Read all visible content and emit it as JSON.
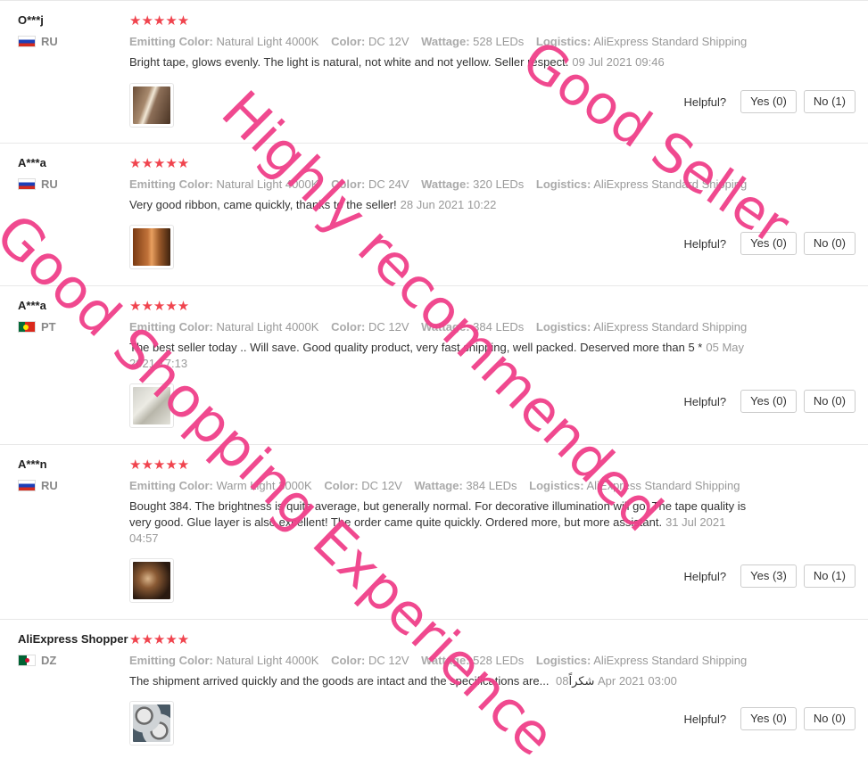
{
  "helpful_label": "Helpful?",
  "colors": {
    "stars": "#f0444e",
    "watermark": "#f0408a"
  },
  "reviews": [
    {
      "user": "O***j",
      "country": "RU",
      "flag": "flag-russia-icon",
      "stars": "★★★★★",
      "attrs": [
        {
          "label": "Emitting Color:",
          "value": "Natural Light 4000K"
        },
        {
          "label": "Color:",
          "value": "DC 12V"
        },
        {
          "label": "Wattage:",
          "value": "528 LEDs"
        },
        {
          "label": "Logistics:",
          "value": "AliExpress Standard Shipping"
        }
      ],
      "text": "Bright tape, glows evenly. The light is natural, not white and not yellow. Seller respect.",
      "date": "09 Jul 2021 09:46",
      "yes": "Yes (0)",
      "no": "No (1)"
    },
    {
      "user": "A***a",
      "country": "RU",
      "flag": "flag-russia-icon",
      "stars": "★★★★★",
      "attrs": [
        {
          "label": "Emitting Color:",
          "value": "Natural Light 4000K"
        },
        {
          "label": "Color:",
          "value": "DC 24V"
        },
        {
          "label": "Wattage:",
          "value": "320 LEDs"
        },
        {
          "label": "Logistics:",
          "value": "AliExpress Standard Shipping"
        }
      ],
      "text": "Very good ribbon, came quickly, thanks to the seller!",
      "date": "28 Jun 2021 10:22",
      "yes": "Yes (0)",
      "no": "No (0)"
    },
    {
      "user": "A***a",
      "country": "PT",
      "flag": "flag-portugal-icon",
      "stars": "★★★★★",
      "attrs": [
        {
          "label": "Emitting Color:",
          "value": "Natural Light 4000K"
        },
        {
          "label": "Color:",
          "value": "DC 12V"
        },
        {
          "label": "Wattage:",
          "value": "384 LEDs"
        },
        {
          "label": "Logistics:",
          "value": "AliExpress Standard Shipping"
        }
      ],
      "text": "The best seller today .. Will save. Good quality product, very fast shipping, well packed. Deserved more than 5 *",
      "date": "05 May 2021 17:13",
      "yes": "Yes (0)",
      "no": "No (0)"
    },
    {
      "user": "A***n",
      "country": "RU",
      "flag": "flag-russia-icon",
      "stars": "★★★★★",
      "attrs": [
        {
          "label": "Emitting Color:",
          "value": "Warm Light 3000K"
        },
        {
          "label": "Color:",
          "value": "DC 12V"
        },
        {
          "label": "Wattage:",
          "value": "384 LEDs"
        },
        {
          "label": "Logistics:",
          "value": "AliExpress Standard Shipping"
        }
      ],
      "text": "Bought 384. The brightness is quite average, but generally normal. For decorative illumination will go. The tape quality is very good. Glue layer is also excellent! The order came quite quickly. Ordered more, but more assistant.",
      "date": "31 Jul 2021 04:57",
      "yes": "Yes (3)",
      "no": "No (1)"
    },
    {
      "user": "AliExpress Shopper",
      "country": "DZ",
      "flag": "flag-algeria-icon",
      "stars": "★★★★★",
      "attrs": [
        {
          "label": "Emitting Color:",
          "value": "Natural Light 4000K"
        },
        {
          "label": "Color:",
          "value": "DC 12V"
        },
        {
          "label": "Wattage:",
          "value": "528 LEDs"
        },
        {
          "label": "Logistics:",
          "value": "AliExpress Standard Shipping"
        }
      ],
      "text": "The shipment arrived quickly and the goods are intact and the specifications are... شكراً",
      "date": "08 Apr 2021 03:00",
      "yes": "Yes (0)",
      "no": "No (0)"
    }
  ],
  "watermarks": [
    "Good Seller",
    "Highly recommended",
    "Good Shopping Experience"
  ]
}
